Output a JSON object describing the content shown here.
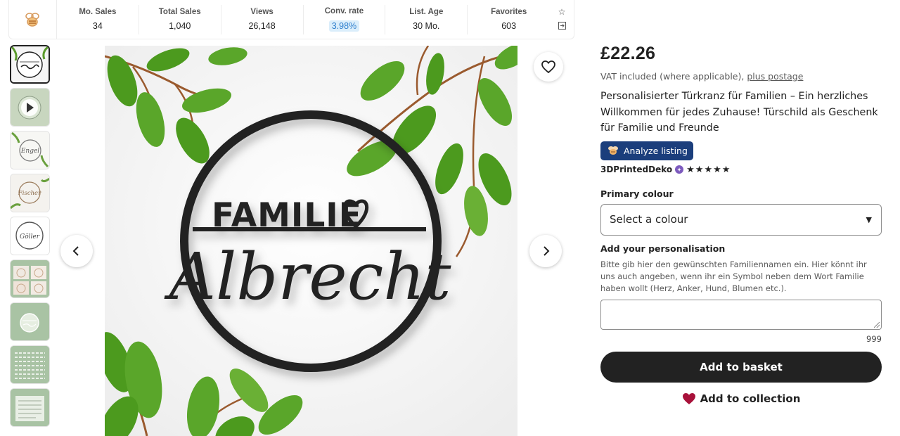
{
  "stats": {
    "items": [
      {
        "label": "Mo. Sales",
        "value": "34"
      },
      {
        "label": "Total Sales",
        "value": "1,040"
      },
      {
        "label": "Views",
        "value": "26,148"
      },
      {
        "label": "Conv. rate",
        "value": "3.98%"
      },
      {
        "label": "List. Age",
        "value": "30 Mo."
      },
      {
        "label": "Favorites",
        "value": "603"
      }
    ]
  },
  "thumbnails": {
    "thumb_3_text": "Engel",
    "thumb_4_text": "Fischer",
    "thumb_5_text": "Göller"
  },
  "main_image": {
    "line1": "FAMILIE",
    "line2": "Albrecht"
  },
  "product": {
    "price": "£22.26",
    "vat_text": "VAT included (where applicable),",
    "postage_link": "plus postage",
    "title": "Personalisierter Türkranz für Familien – Ein herzliches Willkommen für jedes Zuhause! Türschild als Geschenk für Familie und Freunde",
    "analyze_label": "Analyze listing",
    "seller": "3DPrintedDeko",
    "rating_stars": "★★★★★"
  },
  "options": {
    "colour_label": "Primary colour",
    "colour_select_value": "Select a colour",
    "personalisation_label": "Add your personalisation",
    "personalisation_help": "Bitte gib hier den gewünschten Familiennamen ein. Hier könnt ihr uns auch angeben, wenn ihr ein Symbol neben dem Wort Familie haben wollt (Herz, Anker, Hund, Blumen etc.).",
    "char_counter": "999"
  },
  "actions": {
    "basket_label": "Add to basket",
    "collection_label": "Add to collection"
  },
  "colors": {
    "accent_blue": "#1b3e7c",
    "heart_red": "#a8113a",
    "leaf_green": "#4c9a1e",
    "sign_black": "#222222"
  }
}
